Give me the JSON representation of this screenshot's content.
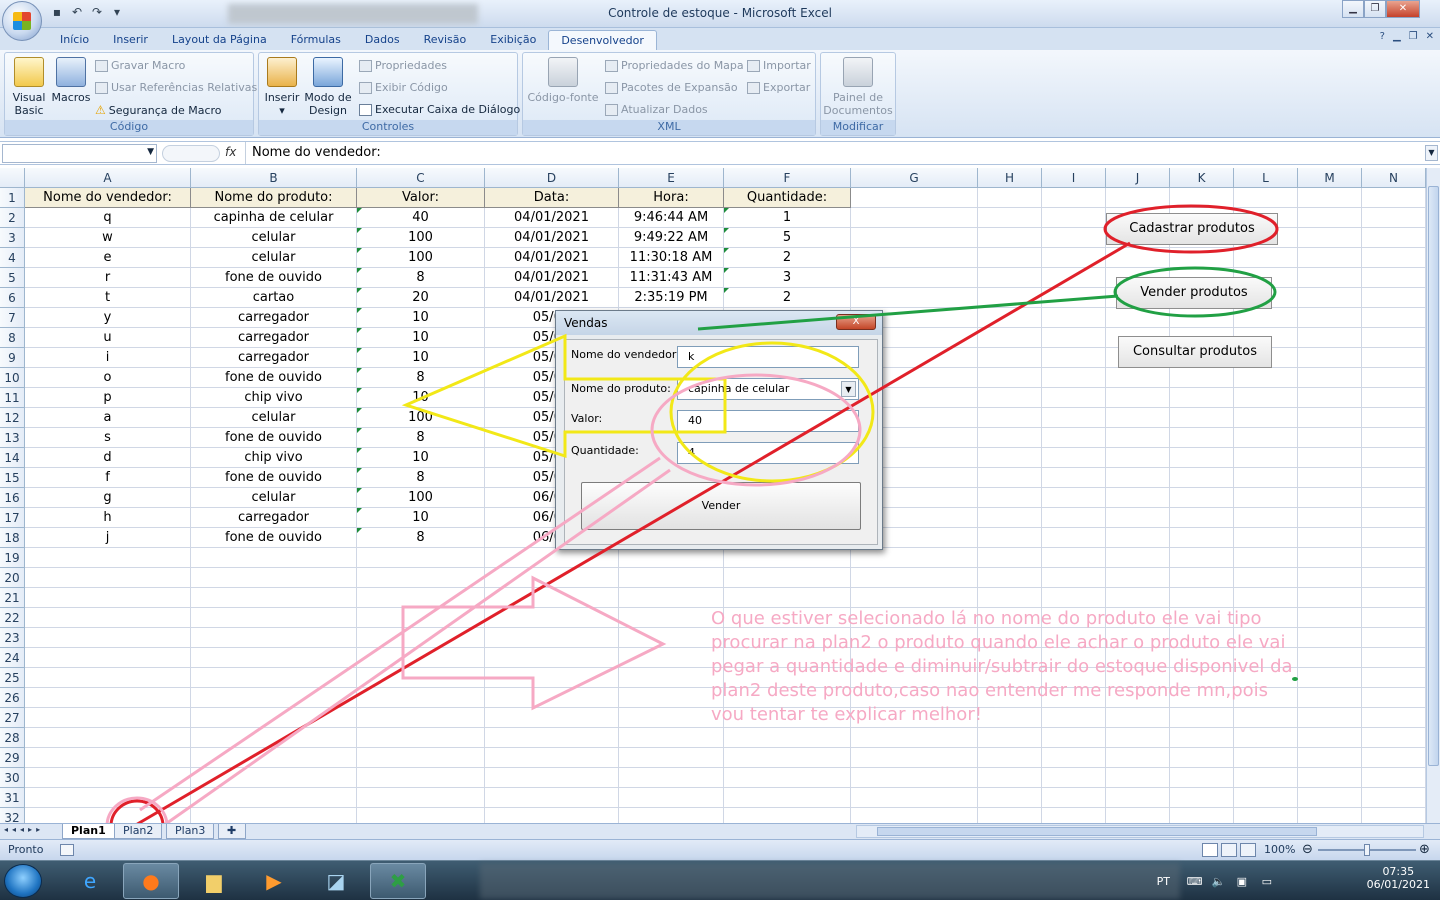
{
  "window": {
    "title": "Controle de estoque - Microsoft Excel"
  },
  "tabs": [
    "Início",
    "Inserir",
    "Layout da Página",
    "Fórmulas",
    "Dados",
    "Revisão",
    "Exibição",
    "Desenvolvedor"
  ],
  "ribbon": {
    "codigo": {
      "label": "Código",
      "visual_basic": "Visual Basic",
      "macros": "Macros",
      "gravar_macro": "Gravar Macro",
      "usar_ref": "Usar Referências Relativas",
      "seguranca": "Segurança de Macro"
    },
    "controles": {
      "label": "Controles",
      "inserir": "Inserir",
      "modo_design": "Modo de Design",
      "propriedades": "Propriedades",
      "exibir_codigo": "Exibir Código",
      "executar": "Executar Caixa de Diálogo"
    },
    "xml": {
      "label": "XML",
      "codigo_fonte": "Código-fonte",
      "prop_mapa": "Propriedades do Mapa",
      "pacotes": "Pacotes de Expansão",
      "atualizar": "Atualizar Dados",
      "importar": "Importar",
      "exportar": "Exportar"
    },
    "modificar": {
      "label": "Modificar",
      "painel": "Painel de Documentos"
    }
  },
  "formula_bar": {
    "fx": "fx",
    "value": "Nome do vendedor:"
  },
  "columns": [
    "A",
    "B",
    "C",
    "D",
    "E",
    "F",
    "G",
    "H",
    "I",
    "J",
    "K",
    "L",
    "M",
    "N"
  ],
  "headers": [
    "Nome do vendedor:",
    "Nome do produto:",
    "Valor:",
    "Data:",
    "Hora:",
    "Quantidade:"
  ],
  "rows": [
    [
      "q",
      "capinha de celular",
      "40",
      "04/01/2021",
      "9:46:44 AM",
      "1"
    ],
    [
      "w",
      "celular",
      "100",
      "04/01/2021",
      "9:49:22 AM",
      "5"
    ],
    [
      "e",
      "celular",
      "100",
      "04/01/2021",
      "11:30:18 AM",
      "2"
    ],
    [
      "r",
      "fone de ouvido",
      "8",
      "04/01/2021",
      "11:31:43 AM",
      "3"
    ],
    [
      "t",
      "cartao",
      "20",
      "04/01/2021",
      "2:35:19 PM",
      "2"
    ],
    [
      "y",
      "carregador",
      "10",
      "05/01",
      "",
      ""
    ],
    [
      "u",
      "carregador",
      "10",
      "05/01",
      "",
      ""
    ],
    [
      "i",
      "carregador",
      "10",
      "05/01",
      "",
      ""
    ],
    [
      "o",
      "fone de ouvido",
      "8",
      "05/01",
      "",
      ""
    ],
    [
      "p",
      "chip vivo",
      "10",
      "05/01",
      "",
      ""
    ],
    [
      "a",
      "celular",
      "100",
      "05/01",
      "",
      ""
    ],
    [
      "s",
      "fone de ouvido",
      "8",
      "05/01",
      "",
      ""
    ],
    [
      "d",
      "chip vivo",
      "10",
      "05/01",
      "",
      ""
    ],
    [
      "f",
      "fone de ouvido",
      "8",
      "05/01",
      "",
      ""
    ],
    [
      "g",
      "celular",
      "100",
      "06/01",
      "",
      ""
    ],
    [
      "h",
      "carregador",
      "10",
      "06/01",
      "",
      ""
    ],
    [
      "j",
      "fone de ouvido",
      "8",
      "06/01",
      "",
      ""
    ]
  ],
  "row_numbers": [
    "1",
    "2",
    "3",
    "4",
    "5",
    "6",
    "7",
    "8",
    "9",
    "10",
    "11",
    "12",
    "13",
    "14",
    "15",
    "16",
    "17",
    "18",
    "19",
    "20",
    "21",
    "22",
    "23",
    "24",
    "25",
    "26",
    "27",
    "28",
    "29",
    "30",
    "31",
    "32"
  ],
  "buttons": {
    "cadastrar": "Cadastrar produtos",
    "vender": "Vender produtos",
    "consultar": "Consultar produtos"
  },
  "dialog": {
    "title": "Vendas",
    "close": "X",
    "vendedor_label": "Nome do vendedor:",
    "vendedor_value": "k",
    "produto_label": "Nome do produto:",
    "produto_value": "capinha de celular",
    "valor_label": "Valor:",
    "valor_value": "40",
    "quantidade_label": "Quantidade:",
    "quantidade_value": "4",
    "vender_button": "Vender"
  },
  "sheets": [
    "Plan1",
    "Plan2",
    "Plan3"
  ],
  "status": {
    "ready": "Pronto",
    "zoom": "100%"
  },
  "taskbar": {
    "lang": "PT",
    "time": "07:35",
    "date": "06/01/2021"
  },
  "annotation": {
    "note": "O que estiver selecionado lá no nome do produto ele vai tipo procurar na plan2 o produto quando ele achar o produto ele vai pegar a quantidade e diminuir/subtrair do estoque disponivel da plan2 deste produto,caso nao entender me responde mn,pois vou tentar te explicar melhor!"
  },
  "colors": {
    "annotation_red": "#e0202a",
    "annotation_green": "#21a044",
    "annotation_yellow": "#f2e817",
    "annotation_pink": "#f6a9c4"
  }
}
